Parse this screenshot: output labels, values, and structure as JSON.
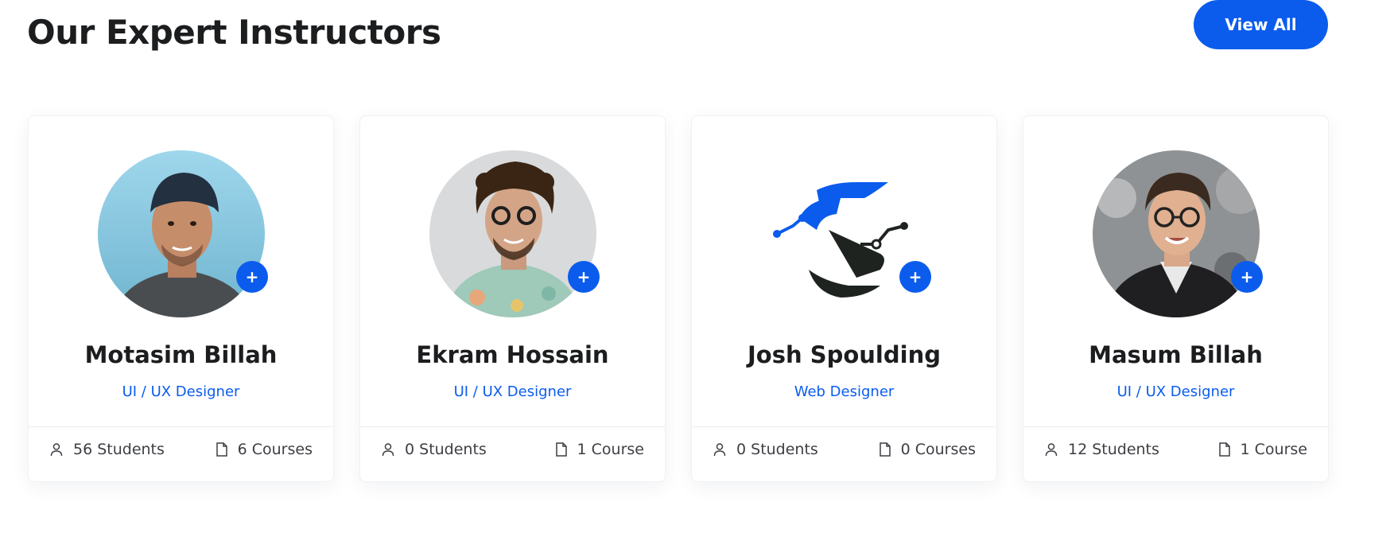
{
  "section": {
    "title": "Our Expert Instructors",
    "view_all_label": "View All"
  },
  "colors": {
    "accent": "#0b5ced",
    "heading": "#1c1d1f",
    "muted": "#3d3f44"
  },
  "instructors": [
    {
      "name": "Motasim Billah",
      "role": "UI / UX Designer",
      "students": "56 Students",
      "courses": "6 Courses",
      "plus": "+",
      "avatar": "photo-man-cap"
    },
    {
      "name": "Ekram Hossain",
      "role": "UI / UX Designer",
      "students": "0 Students",
      "courses": "1 Course",
      "plus": "+",
      "avatar": "photo-man-curly-hair"
    },
    {
      "name": "Josh Spoulding",
      "role": "Web Designer",
      "students": "0 Students",
      "courses": "0 Courses",
      "plus": "+",
      "avatar": "logo-s-mark"
    },
    {
      "name": "Masum Billah",
      "role": "UI / UX Designer",
      "students": "12 Students",
      "courses": "1 Course",
      "plus": "+",
      "avatar": "photo-man-glasses-hoodie"
    }
  ],
  "icons": {
    "students": "user-icon",
    "courses": "file-icon",
    "add": "plus-icon"
  }
}
